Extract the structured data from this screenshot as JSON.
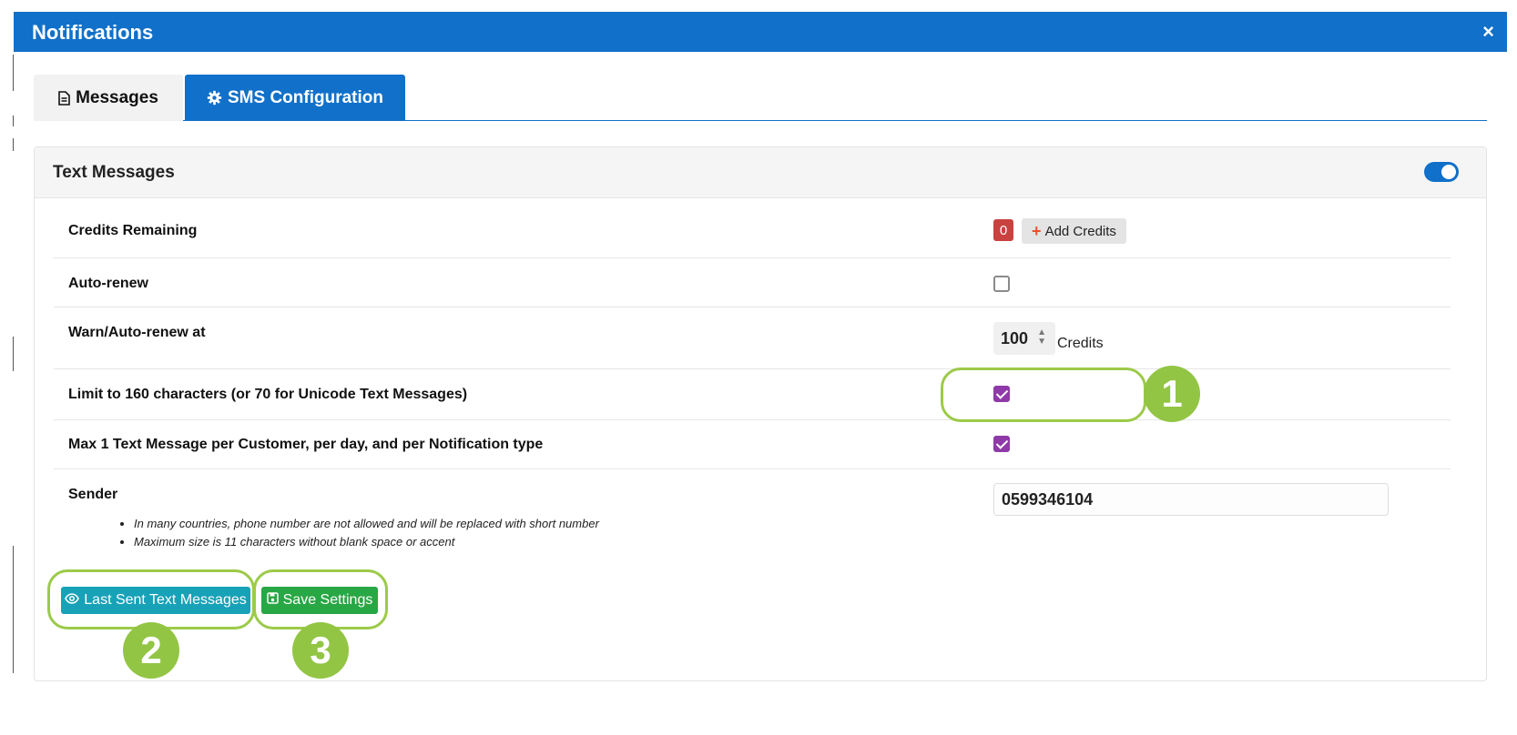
{
  "modal": {
    "title": "Notifications",
    "close_label": "×"
  },
  "tabs": [
    {
      "label": "Messages",
      "icon": "file-text-icon",
      "active": false
    },
    {
      "label": "SMS Configuration",
      "icon": "gear-icon",
      "active": true
    }
  ],
  "section": {
    "title": "Text Messages",
    "enabled": true
  },
  "settings": {
    "credits": {
      "label": "Credits Remaining",
      "value": "0",
      "add_label": "Add Credits",
      "add_icon": "plus-icon"
    },
    "auto_renew": {
      "label": "Auto-renew",
      "checked": false
    },
    "warn_at": {
      "label": "Warn/Auto-renew at",
      "value": "100",
      "unit": "Credits"
    },
    "limit_chars": {
      "label": "Limit to 160 characters (or 70 for Unicode Text Messages)",
      "checked": true
    },
    "max_per_day": {
      "label": "Max 1 Text Message per Customer, per day, and per Notification type",
      "checked": true
    },
    "sender": {
      "label": "Sender",
      "value": "0599346104",
      "notes": [
        "In many countries, phone number are not allowed and will be replaced with short number",
        "Maximum size is 11 characters without blank space or accent"
      ]
    }
  },
  "actions": {
    "last_sent_label": "Last Sent Text Messages",
    "last_sent_icon": "eye-icon",
    "save_label": "Save Settings",
    "save_icon": "floppy-disk-icon"
  },
  "annotations": [
    "1",
    "2",
    "3"
  ],
  "colors": {
    "primary": "#1170c9",
    "danger": "#c9423f",
    "teal": "#17a2b8",
    "green": "#28a745",
    "checkbox": "#8f3aa8",
    "callout": "#93c545"
  }
}
